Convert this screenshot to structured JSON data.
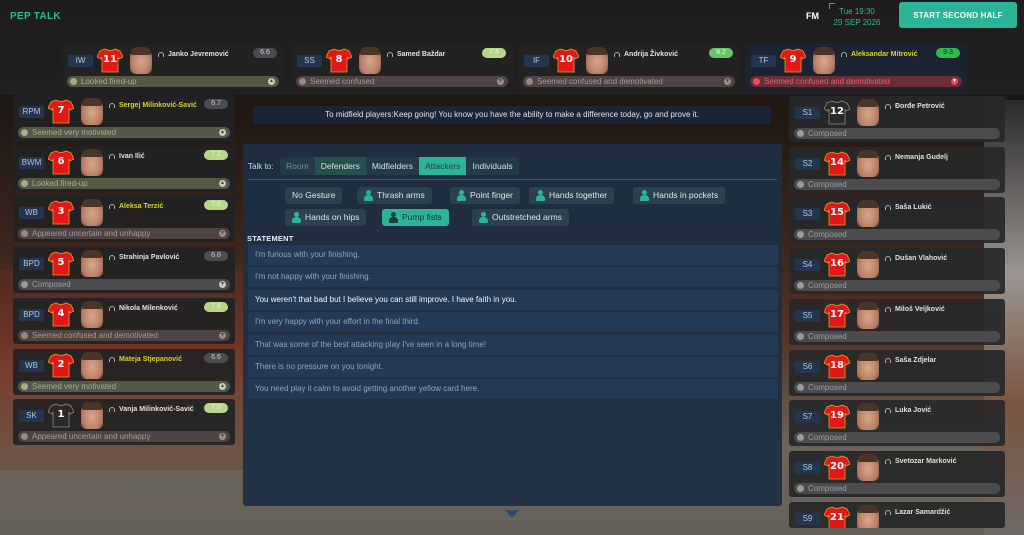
{
  "header": {
    "title": "PEP TALK",
    "logo": "FM",
    "day_time": "Tue 19:30",
    "date": "29 SEP 2026",
    "primary_button": "START SECOND HALF"
  },
  "colors": {
    "accent": "#2bb596",
    "captain_name": "#d4d42c",
    "morale_bad": "#e0505a",
    "panel_bg": "#1e2e44",
    "shirt_red": "#e01818",
    "shirt_trim": "#e0a020",
    "goalkeeper_shirt": "#2a2a2a"
  },
  "attackers": [
    {
      "pos": "IW",
      "number": "11",
      "name": "Janko Jevremović",
      "rating": "6.6",
      "rating_level": "grey",
      "morale": "Looked fired-up",
      "morale_type": "positive",
      "captain": false
    },
    {
      "pos": "SS",
      "number": "8",
      "name": "Samed Baždar",
      "rating": "7.4",
      "rating_level": "lightgreen",
      "morale": "Seemed confused",
      "morale_type": "negative",
      "captain": false
    },
    {
      "pos": "IF",
      "number": "10",
      "name": "Andrija Živković",
      "rating": "8.2",
      "rating_level": "green",
      "morale": "Seemed confused and demotivated",
      "morale_type": "negative",
      "captain": false
    },
    {
      "pos": "TF",
      "number": "9",
      "name": "Aleksandar Mitrović",
      "rating": "9.3",
      "rating_level": "brightgreen",
      "morale": "Seemed confused and demotivated",
      "morale_type": "bad",
      "captain": true
    }
  ],
  "left_players": [
    {
      "pos": "RPM",
      "number": "7",
      "name": "Sergej Milinković-Savić",
      "rating": "6.7",
      "rating_level": "grey",
      "morale": "Seemed very motivated",
      "morale_type": "positive",
      "captain": true,
      "gk": false
    },
    {
      "pos": "BWM",
      "number": "6",
      "name": "Ivan Ilić",
      "rating": "7.2",
      "rating_level": "lightgreen",
      "morale": "Looked fired-up",
      "morale_type": "positive",
      "captain": false,
      "gk": false
    },
    {
      "pos": "WB",
      "number": "3",
      "name": "Aleksa Terzić",
      "rating": "7.6",
      "rating_level": "lightgreen",
      "morale": "Appeared uncertain and unhappy",
      "morale_type": "negative",
      "captain": true,
      "gk": false
    },
    {
      "pos": "BPD",
      "number": "5",
      "name": "Strahinja Pavlović",
      "rating": "6.8",
      "rating_level": "grey",
      "morale": "Composed",
      "morale_type": "neutral",
      "captain": false,
      "gk": false
    },
    {
      "pos": "BPD",
      "number": "4",
      "name": "Nikola Milenković",
      "rating": "7.6",
      "rating_level": "lightgreen",
      "morale": "Seemed confused and demotivated",
      "morale_type": "negative",
      "captain": false,
      "gk": false
    },
    {
      "pos": "WB",
      "number": "2",
      "name": "Mateja Stjepanović",
      "rating": "6.6",
      "rating_level": "grey",
      "morale": "Seemed very motivated",
      "morale_type": "positive",
      "captain": true,
      "gk": false
    },
    {
      "pos": "SK",
      "number": "1",
      "name": "Vanja Milinković-Savić",
      "rating": "7.0",
      "rating_level": "lightgreen",
      "morale": "Appeared uncertain and unhappy",
      "morale_type": "negative",
      "captain": false,
      "gk": true
    }
  ],
  "subs": [
    {
      "pos": "S1",
      "number": "12",
      "name": "Đorđe Petrović",
      "morale": "Composed",
      "gk": true
    },
    {
      "pos": "S2",
      "number": "14",
      "name": "Nemanja Gudelj",
      "morale": "Composed",
      "gk": false
    },
    {
      "pos": "S3",
      "number": "15",
      "name": "Saša Lukić",
      "morale": "Composed",
      "gk": false
    },
    {
      "pos": "S4",
      "number": "16",
      "name": "Dušan Vlahović",
      "morale": "Composed",
      "gk": false
    },
    {
      "pos": "S5",
      "number": "17",
      "name": "Miloš Veljković",
      "morale": "Composed",
      "gk": false
    },
    {
      "pos": "S6",
      "number": "18",
      "name": "Saša Zdjelar",
      "morale": "Composed",
      "gk": false
    },
    {
      "pos": "S7",
      "number": "19",
      "name": "Luka Jović",
      "morale": "Composed",
      "gk": false
    },
    {
      "pos": "S8",
      "number": "20",
      "name": "Svetozar Marković",
      "morale": "Composed",
      "gk": false
    },
    {
      "pos": "S9",
      "number": "21",
      "name": "Lazar Samardžić",
      "morale": "",
      "gk": false
    }
  ],
  "message": "To midfield players:Keep going! You know you have the ability to make a difference today, go and prove it.",
  "talk": {
    "label": "Talk to:",
    "tabs": [
      {
        "label": "Room",
        "state": "disabled"
      },
      {
        "label": "Defenders",
        "state": "dark"
      },
      {
        "label": "Midfielders",
        "state": "normal"
      },
      {
        "label": "Attackers",
        "state": "active"
      },
      {
        "label": "Individuals",
        "state": "normal"
      }
    ],
    "gestures": [
      {
        "label": "No Gesture",
        "icon": "",
        "active": false
      },
      {
        "label": "Thrash arms",
        "icon": "thrash-arms-icon",
        "active": false
      },
      {
        "label": "Point finger",
        "icon": "point-finger-icon",
        "active": false
      },
      {
        "label": "Hands together",
        "icon": "hands-together-icon",
        "active": false
      },
      {
        "label": "Hands in pockets",
        "icon": "hands-in-pockets-icon",
        "active": false
      },
      {
        "label": "Hands on hips",
        "icon": "hands-on-hips-icon",
        "active": false
      },
      {
        "label": "Pump fists",
        "icon": "pump-fists-icon",
        "active": true
      },
      {
        "label": "Outstretched arms",
        "icon": "outstretched-arms-icon",
        "active": false
      }
    ],
    "statement_label": "STATEMENT",
    "statements": [
      {
        "text": "I'm furious with your finishing.",
        "selected": false
      },
      {
        "text": "I'm not happy with your finishing.",
        "selected": false
      },
      {
        "text": "You weren't that bad but I believe you can still improve. I have faith in you.",
        "selected": true
      },
      {
        "text": "I'm very happy with your effort in the final third.",
        "selected": false
      },
      {
        "text": "That was some of the best attacking play I've seen in a long time!",
        "selected": false
      },
      {
        "text": "There is no pressure on you tonight.",
        "selected": false
      },
      {
        "text": "You need play it calm to avoid getting another yellow card here.",
        "selected": false
      }
    ]
  }
}
